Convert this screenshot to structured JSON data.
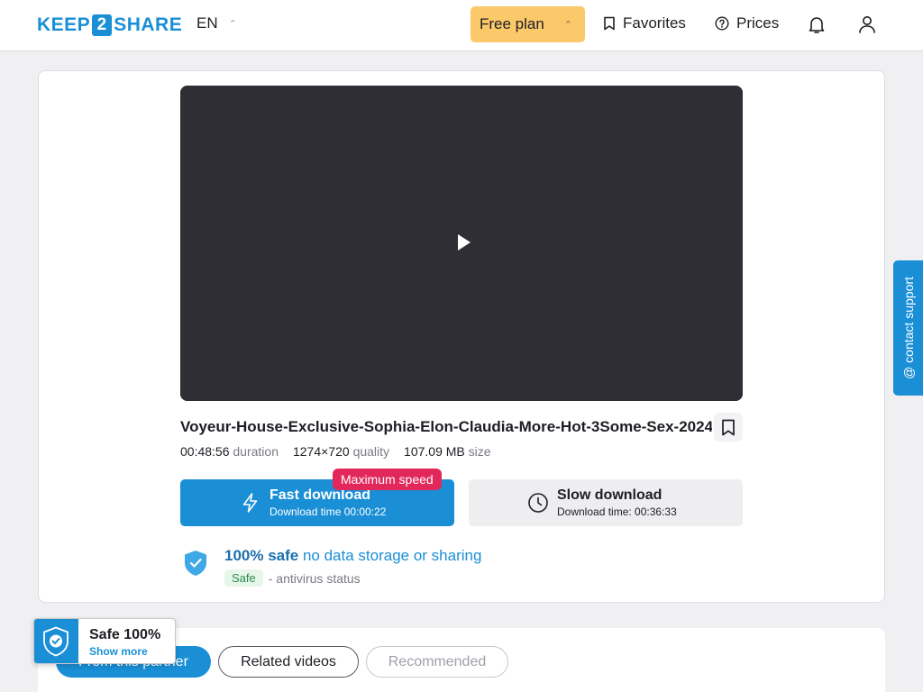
{
  "header": {
    "logo": {
      "left": "KEEP",
      "mid": "2",
      "right": "SHARE"
    },
    "language": "EN",
    "plan_label": "Free plan",
    "favorites_label": "Favorites",
    "prices_label": "Prices"
  },
  "video": {
    "title": "Voyeur-House-Exclusive-Sophia-Elon-Claudia-More-Hot-3Some-Sex-2024-...",
    "duration_value": "00:48:56",
    "duration_label": "duration",
    "quality_value": "1274×720",
    "quality_label": "quality",
    "size_value": "107.09 MB",
    "size_label": "size"
  },
  "download": {
    "fast_label": "Fast download",
    "fast_sub": "Download time 00:00:22",
    "fast_badge": "Maximum speed",
    "slow_label": "Slow download",
    "slow_sub": "Download time: 00:36:33"
  },
  "safety": {
    "strong": "100% safe",
    "rest": "no data storage or sharing",
    "tag": "Safe",
    "status": "- antivirus status"
  },
  "support_label": "@ contact support",
  "tabs": {
    "from_partner": "From this partner",
    "related": "Related videos",
    "recommended": "Recommended"
  },
  "safe_float": {
    "title": "Safe 100%",
    "link": "Show more"
  },
  "colors": {
    "brand": "#1a8fd6",
    "plan": "#fbc86a",
    "badge": "#e2285a"
  }
}
